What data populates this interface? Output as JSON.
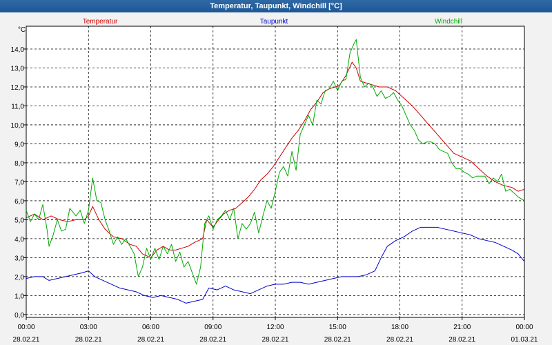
{
  "window": {
    "title": "Temperatur, Taupunkt, Windchill [°C]"
  },
  "chart_data": {
    "type": "line",
    "title": "Temperatur, Taupunkt, Windchill [°C]",
    "ylabel": "°C",
    "ylim": [
      -0.15,
      15.2
    ],
    "xlim": [
      0,
      24
    ],
    "y_ticks": [
      "0,0",
      "1,0",
      "2,0",
      "3,0",
      "4,0",
      "5,0",
      "6,0",
      "7,0",
      "8,0",
      "9,0",
      "10,0",
      "11,0",
      "12,0",
      "13,0",
      "14,0"
    ],
    "x_ticks": [
      {
        "time": "00:00",
        "date": "28.02.21"
      },
      {
        "time": "03:00",
        "date": "28.02.21"
      },
      {
        "time": "06:00",
        "date": "28.02.21"
      },
      {
        "time": "09:00",
        "date": "28.02.21"
      },
      {
        "time": "12:00",
        "date": "28.02.21"
      },
      {
        "time": "15:00",
        "date": "28.02.21"
      },
      {
        "time": "18:00",
        "date": "28.02.21"
      },
      {
        "time": "21:00",
        "date": "28.02.21"
      },
      {
        "time": "00:00",
        "date": "01.03.21"
      }
    ],
    "grid": true,
    "legend": "top",
    "series": [
      {
        "name": "Temperatur",
        "color": "#cc0000",
        "points": [
          [
            0,
            5.1
          ],
          [
            0.4,
            5.3
          ],
          [
            0.8,
            5.0
          ],
          [
            1.2,
            5.2
          ],
          [
            1.6,
            5.0
          ],
          [
            2.0,
            4.9
          ],
          [
            2.4,
            5.0
          ],
          [
            2.8,
            5.0
          ],
          [
            3.0,
            5.2
          ],
          [
            3.2,
            5.7
          ],
          [
            3.5,
            5.0
          ],
          [
            3.8,
            4.5
          ],
          [
            4.2,
            4.1
          ],
          [
            4.6,
            4.0
          ],
          [
            5.0,
            3.7
          ],
          [
            5.3,
            3.6
          ],
          [
            5.6,
            3.2
          ],
          [
            6.0,
            3.0
          ],
          [
            6.3,
            3.4
          ],
          [
            6.6,
            3.6
          ],
          [
            6.9,
            3.4
          ],
          [
            7.2,
            3.4
          ],
          [
            7.5,
            3.5
          ],
          [
            7.8,
            3.6
          ],
          [
            8.1,
            3.8
          ],
          [
            8.5,
            4.0
          ],
          [
            8.7,
            5.0
          ],
          [
            9.0,
            4.6
          ],
          [
            9.2,
            4.9
          ],
          [
            9.5,
            5.3
          ],
          [
            9.8,
            5.5
          ],
          [
            10.1,
            5.6
          ],
          [
            10.4,
            5.9
          ],
          [
            10.7,
            6.2
          ],
          [
            11.0,
            6.6
          ],
          [
            11.3,
            7.1
          ],
          [
            11.6,
            7.4
          ],
          [
            11.9,
            7.8
          ],
          [
            12.2,
            8.3
          ],
          [
            12.5,
            8.8
          ],
          [
            12.8,
            9.3
          ],
          [
            13.1,
            9.7
          ],
          [
            13.4,
            10.2
          ],
          [
            13.7,
            10.8
          ],
          [
            14.0,
            11.2
          ],
          [
            14.3,
            11.7
          ],
          [
            14.6,
            11.9
          ],
          [
            14.9,
            12.0
          ],
          [
            15.1,
            12.1
          ],
          [
            15.4,
            12.6
          ],
          [
            15.7,
            13.3
          ],
          [
            15.9,
            13.0
          ],
          [
            16.1,
            12.3
          ],
          [
            16.4,
            12.2
          ],
          [
            16.7,
            12.1
          ],
          [
            17.0,
            12.0
          ],
          [
            17.4,
            12.0
          ],
          [
            17.8,
            11.8
          ],
          [
            18.2,
            11.4
          ],
          [
            18.6,
            11.0
          ],
          [
            19.0,
            10.5
          ],
          [
            19.4,
            10.0
          ],
          [
            19.8,
            9.5
          ],
          [
            20.2,
            9.0
          ],
          [
            20.6,
            8.5
          ],
          [
            21.0,
            8.3
          ],
          [
            21.4,
            8.1
          ],
          [
            21.8,
            7.7
          ],
          [
            22.2,
            7.3
          ],
          [
            22.6,
            7.0
          ],
          [
            23.0,
            6.8
          ],
          [
            23.4,
            6.7
          ],
          [
            23.7,
            6.5
          ],
          [
            24.0,
            6.6
          ]
        ]
      },
      {
        "name": "Taupunkt",
        "color": "#0000cc",
        "points": [
          [
            0,
            1.9
          ],
          [
            0.4,
            2.0
          ],
          [
            0.8,
            2.0
          ],
          [
            1.1,
            1.8
          ],
          [
            1.5,
            1.9
          ],
          [
            1.9,
            2.0
          ],
          [
            2.3,
            2.1
          ],
          [
            2.7,
            2.2
          ],
          [
            3.0,
            2.3
          ],
          [
            3.3,
            2.0
          ],
          [
            3.7,
            1.8
          ],
          [
            4.1,
            1.6
          ],
          [
            4.5,
            1.4
          ],
          [
            4.9,
            1.3
          ],
          [
            5.3,
            1.2
          ],
          [
            5.7,
            1.0
          ],
          [
            6.1,
            0.9
          ],
          [
            6.5,
            1.0
          ],
          [
            6.9,
            0.9
          ],
          [
            7.3,
            0.8
          ],
          [
            7.7,
            0.6
          ],
          [
            8.1,
            0.7
          ],
          [
            8.5,
            0.8
          ],
          [
            8.8,
            1.4
          ],
          [
            9.2,
            1.3
          ],
          [
            9.6,
            1.5
          ],
          [
            10.0,
            1.3
          ],
          [
            10.4,
            1.2
          ],
          [
            10.8,
            1.1
          ],
          [
            11.2,
            1.3
          ],
          [
            11.6,
            1.5
          ],
          [
            12.0,
            1.6
          ],
          [
            12.4,
            1.6
          ],
          [
            12.8,
            1.7
          ],
          [
            13.2,
            1.7
          ],
          [
            13.6,
            1.6
          ],
          [
            14.0,
            1.7
          ],
          [
            14.4,
            1.8
          ],
          [
            14.8,
            1.9
          ],
          [
            15.2,
            2.0
          ],
          [
            15.6,
            2.0
          ],
          [
            16.0,
            2.0
          ],
          [
            16.4,
            2.1
          ],
          [
            16.8,
            2.3
          ],
          [
            17.1,
            3.0
          ],
          [
            17.4,
            3.6
          ],
          [
            17.8,
            3.9
          ],
          [
            18.2,
            4.1
          ],
          [
            18.6,
            4.4
          ],
          [
            19.0,
            4.6
          ],
          [
            19.4,
            4.6
          ],
          [
            19.8,
            4.6
          ],
          [
            20.2,
            4.5
          ],
          [
            20.6,
            4.4
          ],
          [
            21.0,
            4.3
          ],
          [
            21.4,
            4.2
          ],
          [
            21.8,
            4.0
          ],
          [
            22.2,
            3.9
          ],
          [
            22.6,
            3.8
          ],
          [
            23.0,
            3.6
          ],
          [
            23.4,
            3.4
          ],
          [
            23.7,
            3.2
          ],
          [
            24.0,
            2.8
          ]
        ]
      },
      {
        "name": "Windchill",
        "color": "#00aa00",
        "points": [
          [
            0,
            5.5
          ],
          [
            0.2,
            4.9
          ],
          [
            0.4,
            5.3
          ],
          [
            0.6,
            5.0
          ],
          [
            0.8,
            5.8
          ],
          [
            1.0,
            4.5
          ],
          [
            1.1,
            3.6
          ],
          [
            1.3,
            4.2
          ],
          [
            1.5,
            5.0
          ],
          [
            1.7,
            4.4
          ],
          [
            1.9,
            4.5
          ],
          [
            2.1,
            5.6
          ],
          [
            2.4,
            5.2
          ],
          [
            2.6,
            5.5
          ],
          [
            2.8,
            4.8
          ],
          [
            3.0,
            5.5
          ],
          [
            3.2,
            7.2
          ],
          [
            3.4,
            6.0
          ],
          [
            3.6,
            5.9
          ],
          [
            3.8,
            5.0
          ],
          [
            4.0,
            4.4
          ],
          [
            4.2,
            3.7
          ],
          [
            4.4,
            4.1
          ],
          [
            4.6,
            3.7
          ],
          [
            4.8,
            4.0
          ],
          [
            5.0,
            3.6
          ],
          [
            5.2,
            3.2
          ],
          [
            5.4,
            2.0
          ],
          [
            5.6,
            2.5
          ],
          [
            5.8,
            3.5
          ],
          [
            6.0,
            2.9
          ],
          [
            6.2,
            3.5
          ],
          [
            6.4,
            2.9
          ],
          [
            6.6,
            3.6
          ],
          [
            6.8,
            3.2
          ],
          [
            7.0,
            3.7
          ],
          [
            7.2,
            2.8
          ],
          [
            7.4,
            3.3
          ],
          [
            7.6,
            2.5
          ],
          [
            7.8,
            2.8
          ],
          [
            8.0,
            2.2
          ],
          [
            8.2,
            1.6
          ],
          [
            8.4,
            2.5
          ],
          [
            8.6,
            4.8
          ],
          [
            8.8,
            5.2
          ],
          [
            9.0,
            4.5
          ],
          [
            9.2,
            5.0
          ],
          [
            9.4,
            5.2
          ],
          [
            9.6,
            5.5
          ],
          [
            9.8,
            5.0
          ],
          [
            10.0,
            5.6
          ],
          [
            10.2,
            4.0
          ],
          [
            10.4,
            4.8
          ],
          [
            10.6,
            4.5
          ],
          [
            10.8,
            4.8
          ],
          [
            11.0,
            5.4
          ],
          [
            11.2,
            4.3
          ],
          [
            11.4,
            5.2
          ],
          [
            11.6,
            6.0
          ],
          [
            11.8,
            5.6
          ],
          [
            12.0,
            6.5
          ],
          [
            12.2,
            7.5
          ],
          [
            12.4,
            7.8
          ],
          [
            12.6,
            7.3
          ],
          [
            12.8,
            8.6
          ],
          [
            13.0,
            7.6
          ],
          [
            13.2,
            9.5
          ],
          [
            13.4,
            10.0
          ],
          [
            13.6,
            10.5
          ],
          [
            13.8,
            10.0
          ],
          [
            14.0,
            11.3
          ],
          [
            14.2,
            11.1
          ],
          [
            14.4,
            11.8
          ],
          [
            14.6,
            11.9
          ],
          [
            14.8,
            12.3
          ],
          [
            15.0,
            11.8
          ],
          [
            15.2,
            12.3
          ],
          [
            15.4,
            12.4
          ],
          [
            15.6,
            13.8
          ],
          [
            15.8,
            14.3
          ],
          [
            15.9,
            14.5
          ],
          [
            16.1,
            12.5
          ],
          [
            16.3,
            12.0
          ],
          [
            16.5,
            12.2
          ],
          [
            16.7,
            12.0
          ],
          [
            16.9,
            11.5
          ],
          [
            17.1,
            11.8
          ],
          [
            17.3,
            11.4
          ],
          [
            17.5,
            11.5
          ],
          [
            17.7,
            11.7
          ],
          [
            17.9,
            11.3
          ],
          [
            18.1,
            11.0
          ],
          [
            18.3,
            10.5
          ],
          [
            18.5,
            10.0
          ],
          [
            18.7,
            9.7
          ],
          [
            18.9,
            9.2
          ],
          [
            19.1,
            9.0
          ],
          [
            19.3,
            9.1
          ],
          [
            19.5,
            9.1
          ],
          [
            19.7,
            9.0
          ],
          [
            19.9,
            8.7
          ],
          [
            20.1,
            8.6
          ],
          [
            20.3,
            8.5
          ],
          [
            20.5,
            8.0
          ],
          [
            20.7,
            7.7
          ],
          [
            20.9,
            7.7
          ],
          [
            21.1,
            7.5
          ],
          [
            21.3,
            7.4
          ],
          [
            21.5,
            7.2
          ],
          [
            21.7,
            7.3
          ],
          [
            21.9,
            7.3
          ],
          [
            22.1,
            7.3
          ],
          [
            22.3,
            6.9
          ],
          [
            22.5,
            7.2
          ],
          [
            22.7,
            7.0
          ],
          [
            22.9,
            7.4
          ],
          [
            23.1,
            6.5
          ],
          [
            23.3,
            6.6
          ],
          [
            23.5,
            6.4
          ],
          [
            23.7,
            6.2
          ],
          [
            24.0,
            6.0
          ]
        ]
      }
    ]
  }
}
